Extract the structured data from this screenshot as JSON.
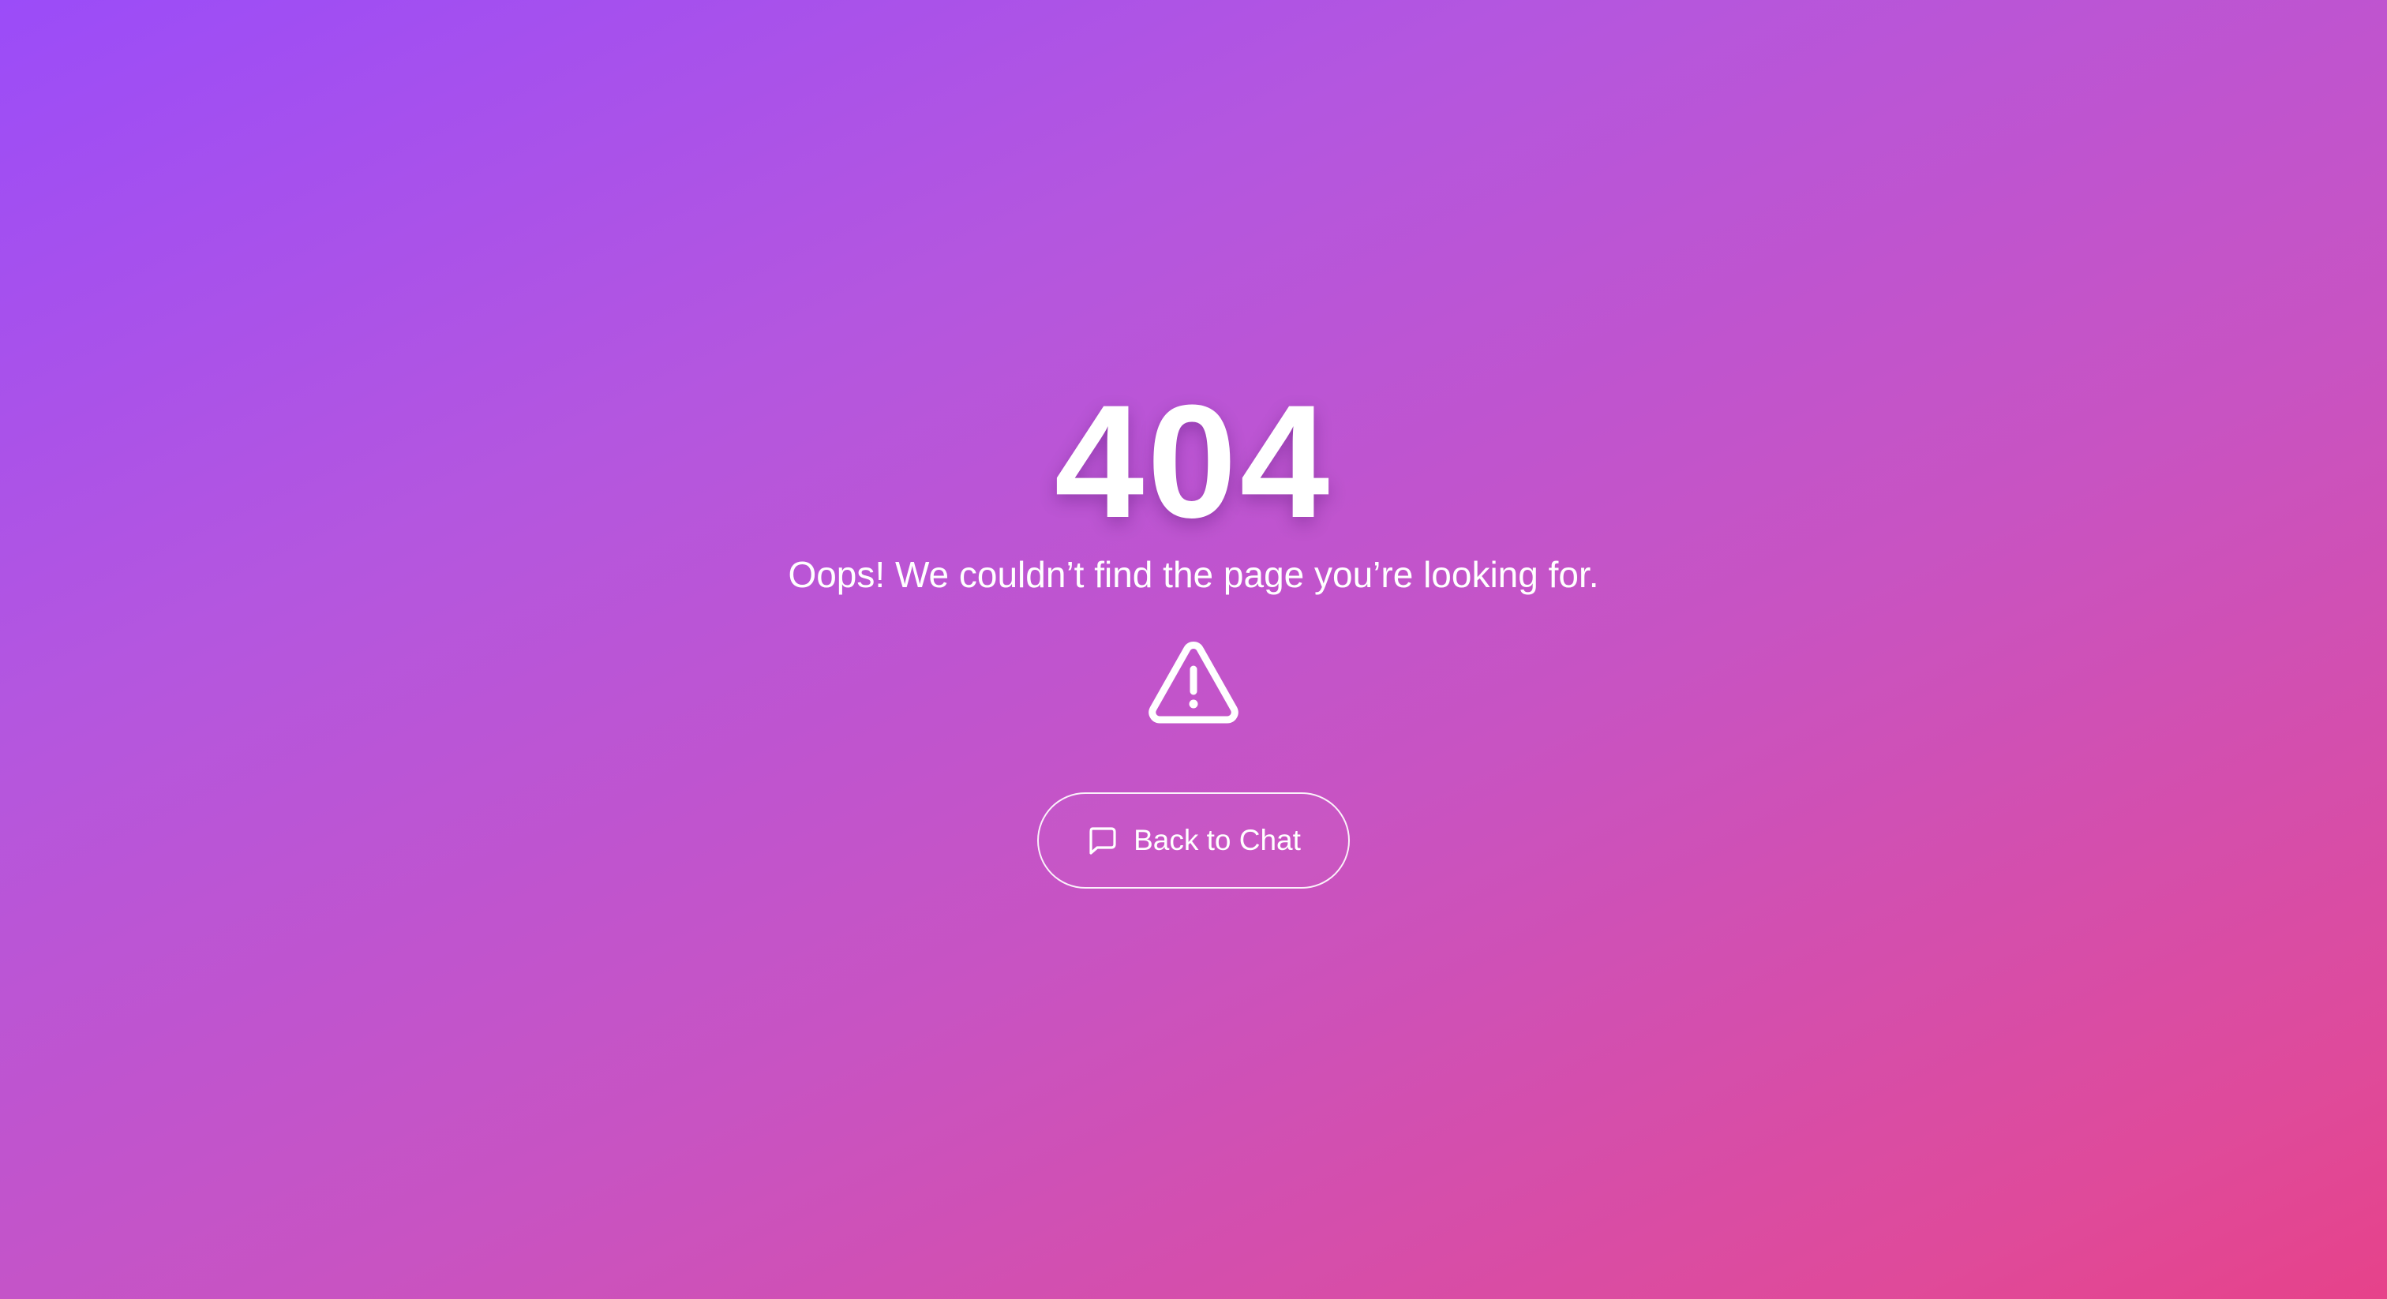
{
  "error": {
    "code": "404",
    "message": "Oops! We couldn’t find the page you’re looking for."
  },
  "icons": {
    "warning": "warning-triangle-icon",
    "chat": "chat-bubble-icon"
  },
  "actions": {
    "back_label": "Back to Chat"
  },
  "colors": {
    "gradient_start": "#9b4cf8",
    "gradient_mid": "#c853c2",
    "gradient_end": "#e6428a",
    "text": "#ffffff"
  }
}
